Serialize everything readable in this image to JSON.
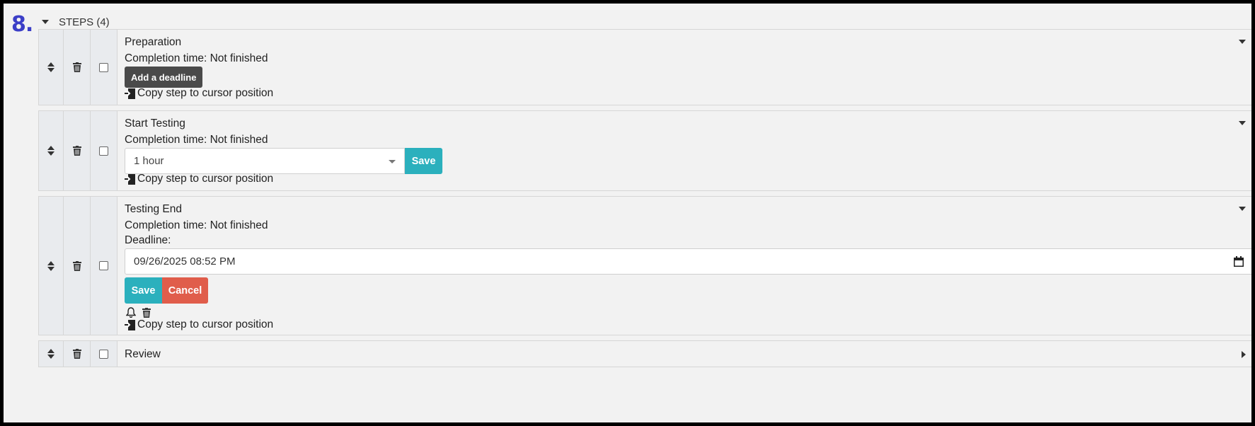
{
  "section": {
    "number": "8.",
    "header": "STEPS (4)"
  },
  "steps": [
    {
      "title": "Preparation",
      "completion": "Completion time: Not finished",
      "add_deadline": "Add a deadline",
      "copy": "Copy step to cursor position"
    },
    {
      "title": "Start Testing",
      "completion": "Completion time: Not finished",
      "duration_value": "1 hour",
      "save": "Save",
      "copy": "Copy step to cursor position"
    },
    {
      "title": "Testing End",
      "completion": "Completion time: Not finished",
      "deadline_label": "Deadline:",
      "deadline_value": "09/26/2025 08:52 PM",
      "save": "Save",
      "cancel": "Cancel",
      "copy": "Copy step to cursor position"
    },
    {
      "title": "Review"
    }
  ],
  "colors": {
    "accent_number": "#3b3ec7",
    "teal": "#2bb0bd",
    "red": "#e05d4b",
    "dark_button": "#4a4a4a"
  },
  "icons": [
    "sort-icon",
    "trash-icon",
    "checkbox",
    "caret-down-icon",
    "caret-right-icon",
    "copy-step-icon",
    "bell-icon",
    "calendar-icon"
  ]
}
